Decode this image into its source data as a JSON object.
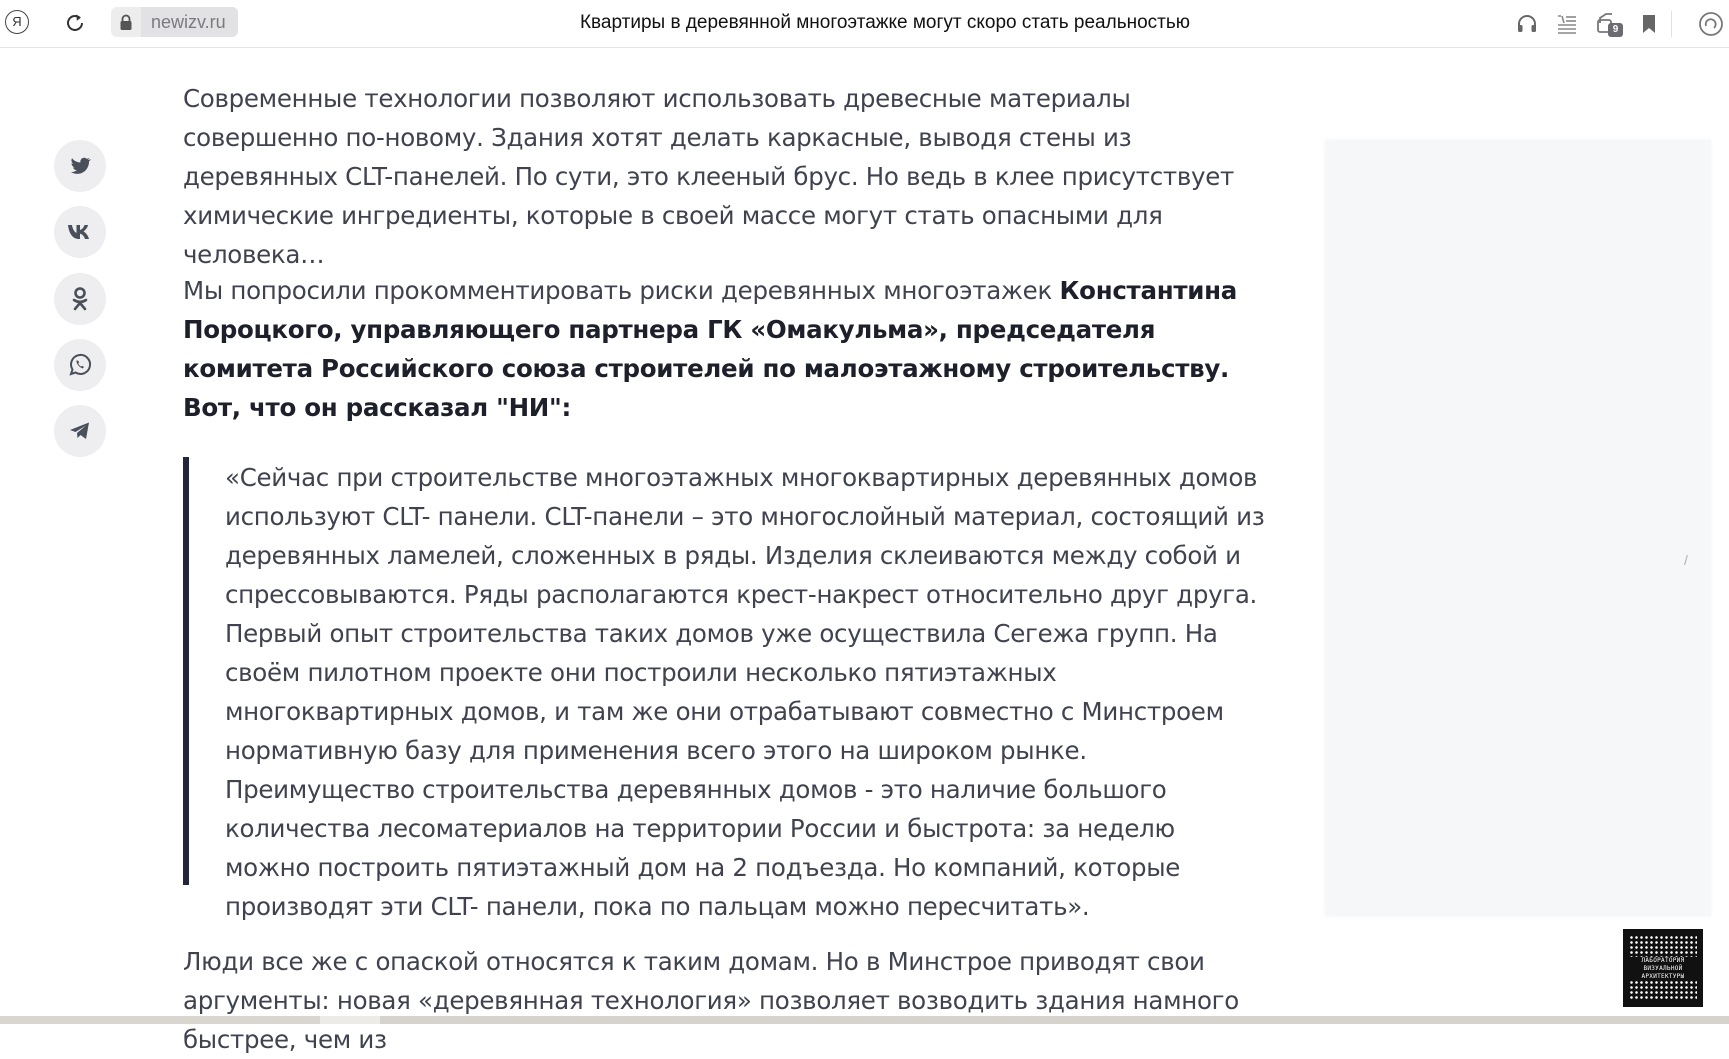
{
  "browser": {
    "logo_letter": "Я",
    "host": "newizv.ru",
    "title": "Квартиры в деревянной многоэтажке могут скоро стать реальностью",
    "tab_count": "9",
    "icons": [
      "yandex-logo-icon",
      "reload-icon",
      "lock-icon",
      "headphones-icon",
      "reader-mode-icon",
      "tabs-icon",
      "bookmark-icon",
      "alice-icon"
    ]
  },
  "share": {
    "icons": [
      "twitter-icon",
      "vk-icon",
      "odnoklassniki-icon",
      "whatsapp-icon",
      "telegram-icon"
    ]
  },
  "article": {
    "p1": "Современные технологии позволяют использовать древесные материалы совершенно по-новому. Здания хотят делать каркасные, выводя стены из деревянных CLT-панелей. По сути, это клееный брус. Но ведь в клее присутствует химические ингредиенты, которые в своей массе могут стать опасными для человека…",
    "p2_intro": "Мы попросили прокомментировать риски деревянных многоэтажек ",
    "p2_bold": "Константина Пороцкого, управляющего партнера ГК «Омакульма», председателя комитета Российского союза строителей по малоэтажному строительству. Вот, что он рассказал \"НИ\":",
    "quote": "«Сейчас при строительстве многоэтажных многоквартирных деревянных домов используют CLT- панели. CLT-панели – это многослойный материал, состоящий из деревянных ламелей, сложенных в ряды. Изделия склеиваются между собой и спрессовываются. Ряды располагаются крест-накрест относительно друг друга. Первый опыт строительства таких домов уже осуществила Сегежа групп. На своём пилотном проекте они построили несколько пятиэтажных многоквартирных домов, и там же они отрабатывают совместно с Минстроем нормативную базу для применения всего этого на широком рынке. Преимущество строительства деревянных домов - это наличие большого количества лесоматериалов на территории России и быстрота: за неделю можно построить пятиэтажный дом на 2 подъезда. Но компаний, которые производят эти CLT- панели, пока по пальцам можно пересчитать».",
    "p3": "Люди все же с опаской относятся к таким домам. Но в Минстрое приводят свои аргументы: новая «деревянная технология» позволяет возводить здания намного быстрее, чем из"
  },
  "sidebar": {
    "mark": "/"
  },
  "badge": {
    "text": "ЛАБОРАТОРИЯ ВИЗУАЛЬНОЙ АРХИТЕКТУРЫ"
  },
  "colors": {
    "quote_bar": "#23253a",
    "share_bg": "#eeeef0",
    "share_icon": "#4a4f5c"
  }
}
